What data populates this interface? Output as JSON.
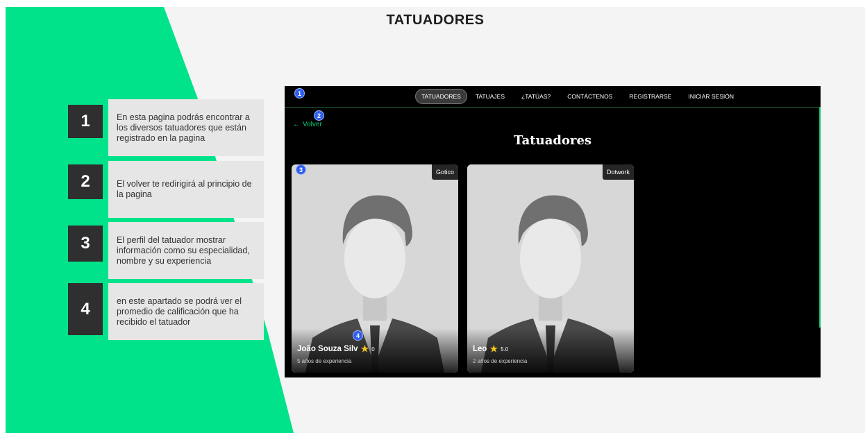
{
  "slide_title": "TATUADORES",
  "steps": [
    {
      "number": "1",
      "text": "En esta pagina podrás encontrar a los diversos tatuadores que están registrado en la pagina"
    },
    {
      "number": "2",
      "text": "El volver te redirigirá al principio de la pagina"
    },
    {
      "number": "3",
      "text": "El perfil del tatuador mostrar información como su especialidad, nombre y su experiencia"
    },
    {
      "number": "4",
      "text": "en este apartado se podrá ver el promedio  de calificación que ha recibido el tatuador"
    }
  ],
  "app": {
    "nav": {
      "items": [
        "TATUADORES",
        "TATUAJES",
        "¿TATÚAS?",
        "CONTÁCTENOS",
        "REGISTRARSE",
        "INICIAR SESIÓN"
      ],
      "active": "TATUADORES"
    },
    "back_label": "Volver",
    "page_title": "Tatuadores",
    "cards": [
      {
        "name": "João Souza Silv",
        "rating": "0",
        "experience": "5 años de experiencia",
        "specialty": "Gotico"
      },
      {
        "name": "Leo",
        "rating": "5.0",
        "experience": "2 años de experiencia",
        "specialty": "Dotwork"
      }
    ],
    "badges": [
      "1",
      "2",
      "3",
      "4"
    ]
  },
  "colors": {
    "accent_green": "#00e38a",
    "dark": "#2f2f2f",
    "badge_blue": "#2f5ff0",
    "star": "#f5c518"
  }
}
